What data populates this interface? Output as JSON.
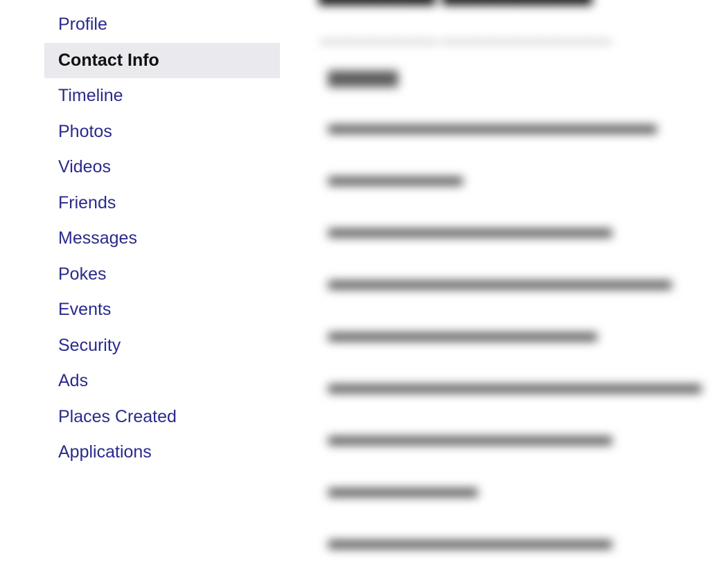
{
  "sidebar": {
    "items": [
      {
        "label": "Profile",
        "active": false
      },
      {
        "label": "Contact Info",
        "active": true
      },
      {
        "label": "Timeline",
        "active": false
      },
      {
        "label": "Photos",
        "active": false
      },
      {
        "label": "Videos",
        "active": false
      },
      {
        "label": "Friends",
        "active": false
      },
      {
        "label": "Messages",
        "active": false
      },
      {
        "label": "Pokes",
        "active": false
      },
      {
        "label": "Events",
        "active": false
      },
      {
        "label": "Security",
        "active": false
      },
      {
        "label": "Ads",
        "active": false
      },
      {
        "label": "Places Created",
        "active": false
      },
      {
        "label": "Applications",
        "active": false
      }
    ]
  },
  "colors": {
    "link": "#2a2a8c",
    "active_bg": "#e9e9ee",
    "active_text": "#111111"
  }
}
